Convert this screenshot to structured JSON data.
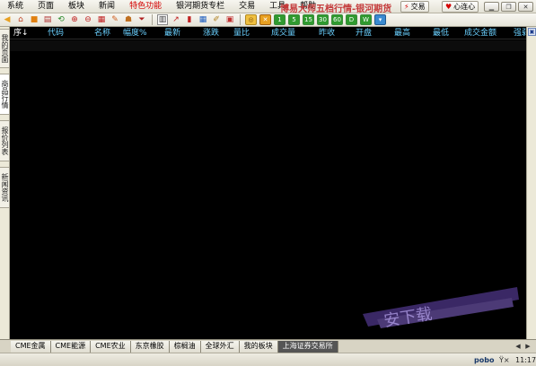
{
  "menubar": {
    "items": [
      "系统",
      "页面",
      "板块",
      "新闻",
      "特色功能",
      "银河期货专栏",
      "交易",
      "工具",
      "帮助"
    ],
    "title": "博易大师五档行情-银河期货",
    "trade_button": "交易",
    "heart_button": "心连心"
  },
  "toolbar": {
    "periods": [
      "1",
      "5",
      "15",
      "30",
      "60",
      "D",
      "W"
    ]
  },
  "left_tabs": [
    "我的页面",
    "商品行情",
    "报价列表",
    "新闻资讯"
  ],
  "grid": {
    "columns": [
      "序↓",
      "代码",
      "名称",
      "幅度%",
      "最新",
      "涨跌",
      "量比",
      "成交量",
      "昨收",
      "开盘",
      "最高",
      "最低",
      "成交金额",
      "强弱"
    ]
  },
  "bottom_tabs": [
    "CME金属",
    "CME能源",
    "CME农业",
    "东京橡胶",
    "棕榈油",
    "全球外汇",
    "我的板块",
    "上海证券交易所"
  ],
  "statusbar": {
    "brand": "pobo",
    "time": "11:17"
  },
  "watermark": {
    "text": "安下载"
  }
}
